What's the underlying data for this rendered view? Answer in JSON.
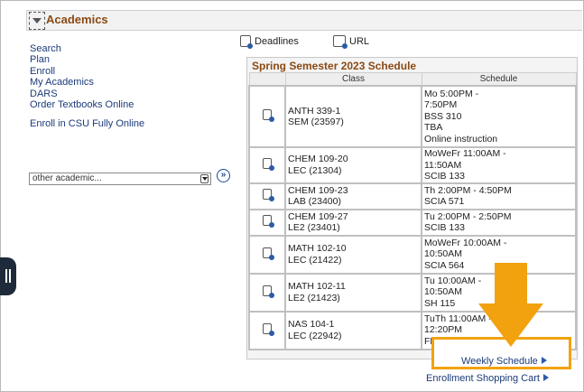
{
  "header": {
    "title": "Academics"
  },
  "links": {
    "search": "Search",
    "plan": "Plan",
    "enroll": "Enroll",
    "my_academics": "My Academics",
    "dars": "DARS",
    "textbooks": "Order Textbooks Online",
    "csu_online": "Enroll in CSU Fully Online"
  },
  "select": {
    "value": "other academic..."
  },
  "toolbar": {
    "deadlines": "Deadlines",
    "url": "URL"
  },
  "schedule": {
    "title": "Spring Semester 2023 Schedule",
    "col_class": "Class",
    "col_schedule": "Schedule",
    "rows": [
      {
        "cls": [
          "ANTH 339-1",
          "SEM (23597)"
        ],
        "sched": [
          "Mo 5:00PM -",
          "7:50PM",
          "BSS 310",
          "TBA",
          "Online instruction"
        ]
      },
      {
        "cls": [
          "CHEM 109-20",
          "LEC (21304)"
        ],
        "sched": [
          "MoWeFr 11:00AM -",
          "11:50AM",
          "SCIB 133"
        ]
      },
      {
        "cls": [
          "CHEM 109-23",
          "LAB (23400)"
        ],
        "sched": [
          "Th 2:00PM - 4:50PM",
          "SCIA 571"
        ]
      },
      {
        "cls": [
          "CHEM 109-27",
          "LE2 (23401)"
        ],
        "sched": [
          "Tu 2:00PM - 2:50PM",
          "SCIB 133"
        ]
      },
      {
        "cls": [
          "MATH 102-10",
          "LEC (21422)"
        ],
        "sched": [
          "MoWeFr 10:00AM -",
          "10:50AM",
          "SCIA 564"
        ]
      },
      {
        "cls": [
          "MATH 102-11",
          "LE2 (21423)"
        ],
        "sched": [
          "Tu 10:00AM -",
          "10:50AM",
          "SH 115"
        ]
      },
      {
        "cls": [
          "NAS 104-1",
          "LEC (22942)"
        ],
        "sched": [
          "TuTh 11:00AM -",
          "12:20PM",
          "FH 118"
        ]
      }
    ]
  },
  "weekly_schedule": "Weekly Schedule",
  "enrollment_cart": "Enrollment Shopping Cart",
  "colors": {
    "highlight": "#f2a20f",
    "header_text": "#8a4a14",
    "link": "#1a3a7a"
  }
}
